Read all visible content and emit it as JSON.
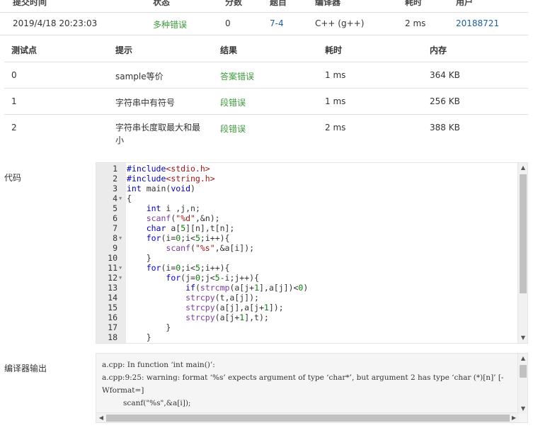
{
  "submission": {
    "headers": [
      "提交时间",
      "状态",
      "分数",
      "题目",
      "编译器",
      "耗时",
      "用户"
    ],
    "time": "2019/4/18 20:23:03",
    "status": "多种错误",
    "score": "0",
    "problem": "7-4",
    "compiler": "C++ (g++)",
    "duration": "2 ms",
    "user": "20188721"
  },
  "testcases": {
    "headers": [
      "测试点",
      "提示",
      "结果",
      "耗时",
      "内存"
    ],
    "rows": [
      {
        "id": "0",
        "hint": "sample等价",
        "result": "答案错误",
        "time": "1 ms",
        "memory": "364 KB"
      },
      {
        "id": "1",
        "hint": "字符串中有符号",
        "result": "段错误",
        "time": "1 ms",
        "memory": "256 KB"
      },
      {
        "id": "2",
        "hint": "字符串长度取最大和最小",
        "result": "段错误",
        "time": "2 ms",
        "memory": "388 KB"
      }
    ]
  },
  "code_label": "代码",
  "compiler_output_label": "编译器输出",
  "code_line_numbers": [
    "1",
    "2",
    "3",
    "4",
    "5",
    "6",
    "7",
    "8",
    "9",
    "10",
    "11",
    "12",
    "13",
    "14",
    "15",
    "16",
    "17",
    "18"
  ],
  "compiler_output": "a.cpp: In function ‘int main()’:\na.cpp:9:25: warning: format ‘%s’ expects argument of type ‘char*’, but argument 2 has type ‘char (*)[n]’ [-Wformat=]\n         scanf(\"%s\",&a[i]);"
}
